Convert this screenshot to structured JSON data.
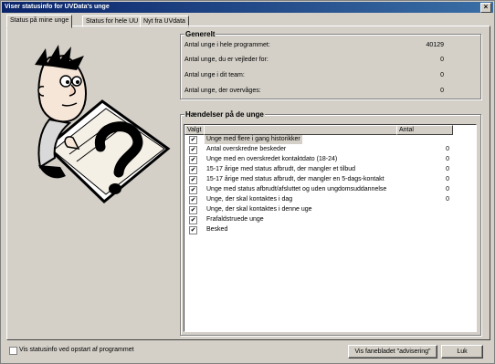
{
  "window": {
    "title": "Viser statusinfo for UVData's unge",
    "close_glyph": "×"
  },
  "tabs": [
    {
      "label": "Status på mine unge",
      "active": true
    },
    {
      "label": "Status for hele UU",
      "active": false
    },
    {
      "label": "Nyt fra UVdata",
      "active": false
    }
  ],
  "generelt": {
    "title": "Generelt",
    "rows": [
      {
        "label": "Antal unge i hele programmet:",
        "value": "40129"
      },
      {
        "label": "Antal unge, du er vejleder for:",
        "value": "0"
      },
      {
        "label": "Antal unge i dit team:",
        "value": "0"
      },
      {
        "label": "Antal unge, der overvåges:",
        "value": "0"
      }
    ]
  },
  "haendelser": {
    "title": "Hændelser på de unge",
    "columns": {
      "valgt": "Valgt",
      "name": "",
      "antal": "Antal"
    },
    "rows": [
      {
        "checked": true,
        "name": "Unge med flere i gang historikker",
        "count": ""
      },
      {
        "checked": true,
        "name": "Antal overskredne beskeder",
        "count": "0"
      },
      {
        "checked": true,
        "name": "Unge med en overskredet kontaktdato (18-24)",
        "count": "0"
      },
      {
        "checked": true,
        "name": "15-17 årige med status afbrudt, der mangler et tilbud",
        "count": "0"
      },
      {
        "checked": true,
        "name": "15-17 årige med status afbrudt, der mangler en 5-dags-kontakt",
        "count": "0"
      },
      {
        "checked": true,
        "name": "Unge med status afbrudt/afsluttet og uden ungdomsuddannelse",
        "count": "0"
      },
      {
        "checked": true,
        "name": "Unge, der skal kontaktes i dag",
        "count": "0"
      },
      {
        "checked": true,
        "name": "Unge, der skal kontaktes i denne uge",
        "count": ""
      },
      {
        "checked": true,
        "name": "Frafaldstruede unge",
        "count": ""
      },
      {
        "checked": true,
        "name": "Besked",
        "count": ""
      }
    ]
  },
  "footer": {
    "startup_checkbox_label": "Vis statusinfo ved opstart af programmet",
    "startup_checked": false,
    "advisering_button": "Vis fanebladet \"advisering\"",
    "close_button": "Luk"
  },
  "icons": {
    "illustration": "thinking-man-question-mark-illustration",
    "check": "✔"
  }
}
